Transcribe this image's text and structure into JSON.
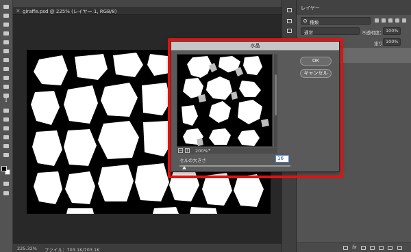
{
  "document": {
    "tab_title": "giraffe.psd @ 225% (レイヤー 1, RGB/8)",
    "close_glyph": "×"
  },
  "toolbar": {
    "tools": [
      "move-icon",
      "marquee-icon",
      "lasso-icon",
      "quick-select-icon",
      "crop-icon",
      "eyedropper-icon",
      "healing-icon",
      "brush-icon",
      "stamp-icon",
      "history-brush-icon",
      "eraser-icon",
      "gradient-icon",
      "blur-icon",
      "dodge-icon",
      "pen-icon",
      "type-icon",
      "path-select-icon",
      "shape-icon",
      "hand-icon",
      "zoom-icon"
    ],
    "type_tool_glyph": "T",
    "foreground_color": "#000000",
    "background_color": "#ffffff"
  },
  "status_bar": {
    "zoom": "225.32%",
    "file_info": "ファイル：703.1K/703.1K"
  },
  "layers_panel": {
    "tab_label": "レイヤー",
    "kind_filter": "種類",
    "blend_mode": "通常",
    "opacity_label": "不透明度：",
    "opacity_value": "100%",
    "fill_label": "塗り：",
    "fill_value": "100%",
    "footer_fx": "fx"
  },
  "filter_dialog": {
    "title": "水晶",
    "ok_label": "OK",
    "cancel_label": "キャンセル",
    "preview_zoom": "200%",
    "zoom_out_glyph": "−",
    "zoom_in_glyph": "+",
    "cell_size_label": "セルの大きさ",
    "cell_size_value": "16"
  },
  "highlight_color": "#e01212"
}
